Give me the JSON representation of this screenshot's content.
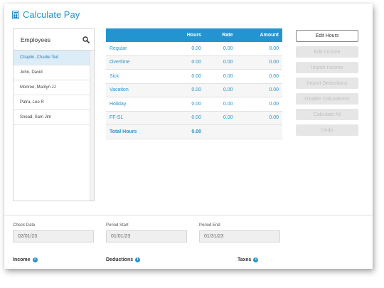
{
  "app": {
    "title": "Calculate Pay",
    "title_icon": "calculator-icon"
  },
  "employees": {
    "header": "Employees",
    "search_icon": "search-icon",
    "items": [
      {
        "name": "Chaplin, Charlie Ted",
        "selected": true
      },
      {
        "name": "John, David",
        "selected": false
      },
      {
        "name": "Monroe, Marilyn JJ",
        "selected": false
      },
      {
        "name": "Patra, Leo R",
        "selected": false
      },
      {
        "name": "Snead, Sam Jim",
        "selected": false
      }
    ]
  },
  "pay_table": {
    "headers": {
      "label": "",
      "hours": "Hours",
      "rate": "Rate",
      "amount": "Amount"
    },
    "rows": [
      {
        "label": "Regular",
        "hours": "0.00",
        "rate": "0.00",
        "amount": "0.00"
      },
      {
        "label": "Overtime",
        "hours": "0.00",
        "rate": "0.00",
        "amount": "0.00"
      },
      {
        "label": "Sick",
        "hours": "0.00",
        "rate": "0.00",
        "amount": "0.00"
      },
      {
        "label": "Vacation",
        "hours": "0.00",
        "rate": "0.00",
        "amount": "0.00"
      },
      {
        "label": "Holiday",
        "hours": "0.00",
        "rate": "0.00",
        "amount": "0.00"
      },
      {
        "label": "FF-SL",
        "hours": "0.00",
        "rate": "0.00",
        "amount": "0.00"
      }
    ],
    "total": {
      "label": "Total Hours",
      "hours": "0.00"
    }
  },
  "actions": {
    "edit_hours": "Edit Hours",
    "edit_income": "Edit Income",
    "import_income": "Import Income",
    "import_deductions": "Import Deductions",
    "disable_calculations": "Disable Calculations",
    "calculate_all": "Calculate All",
    "undo": "Undo"
  },
  "dates": {
    "check_date": {
      "label": "Check Date",
      "value": "02/01/23"
    },
    "period_start": {
      "label": "Period Start",
      "value": "01/01/23"
    },
    "period_end": {
      "label": "Period End",
      "value": "01/31/23"
    }
  },
  "sections": {
    "income": "Income",
    "deductions": "Deductions",
    "taxes": "Taxes"
  },
  "colors": {
    "accent": "#2a93c9",
    "header_bg": "#2394cf",
    "selected_bg": "#dcedf8"
  }
}
